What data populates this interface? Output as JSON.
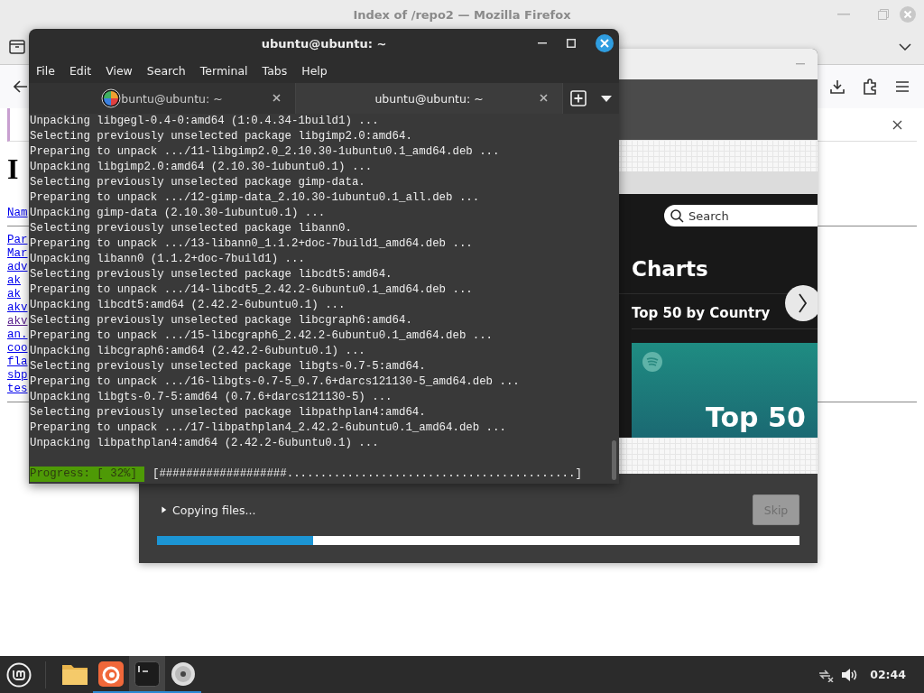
{
  "firefox": {
    "title": "Index of /repo2 — Mozilla Firefox",
    "page": {
      "heading": "I",
      "column_header": "Nam",
      "links": [
        {
          "text": "Par",
          "visited": false
        },
        {
          "text": "Mar",
          "visited": false
        },
        {
          "text": "adv",
          "visited": false
        },
        {
          "text": "ak",
          "visited": false
        },
        {
          "text": "ak",
          "visited": false
        },
        {
          "text": "akv",
          "visited": false
        },
        {
          "text": "akv",
          "visited": true
        },
        {
          "text": "an.",
          "visited": false
        },
        {
          "text": "coo",
          "visited": false
        },
        {
          "text": "fla",
          "visited": false
        },
        {
          "text": "sbp",
          "visited": false
        },
        {
          "text": "tes",
          "visited": false
        }
      ]
    }
  },
  "installer": {
    "slideshow": {
      "search": {
        "placeholder": "Search"
      },
      "title": "Charts",
      "section": "Top 50 by Country",
      "card_title": "Top 50"
    },
    "status": {
      "text": "Copying files...",
      "expanded": false
    },
    "skip": {
      "label": "Skip",
      "disabled": true
    },
    "progress": {
      "level": 0.243
    }
  },
  "terminal": {
    "title": "ubuntu@ubuntu: ~",
    "menu": [
      "File",
      "Edit",
      "View",
      "Search",
      "Terminal",
      "Tabs",
      "Help"
    ],
    "tabs": [
      {
        "label": "buntu@ubuntu: ~",
        "selected": false
      },
      {
        "label": "ubuntu@ubuntu: ~",
        "selected": true
      }
    ],
    "lines": [
      "Unpacking libgegl-0.4-0:amd64 (1:0.4.34-1build1) ...",
      "Selecting previously unselected package libgimp2.0:amd64.",
      "Preparing to unpack .../11-libgimp2.0_2.10.30-1ubuntu0.1_amd64.deb ...",
      "Unpacking libgimp2.0:amd64 (2.10.30-1ubuntu0.1) ...",
      "Selecting previously unselected package gimp-data.",
      "Preparing to unpack .../12-gimp-data_2.10.30-1ubuntu0.1_all.deb ...",
      "Unpacking gimp-data (2.10.30-1ubuntu0.1) ...",
      "Selecting previously unselected package libann0.",
      "Preparing to unpack .../13-libann0_1.1.2+doc-7build1_amd64.deb ...",
      "Unpacking libann0 (1.1.2+doc-7build1) ...",
      "Selecting previously unselected package libcdt5:amd64.",
      "Preparing to unpack .../14-libcdt5_2.42.2-6ubuntu0.1_amd64.deb ...",
      "Unpacking libcdt5:amd64 (2.42.2-6ubuntu0.1) ...",
      "Selecting previously unselected package libcgraph6:amd64.",
      "Preparing to unpack .../15-libcgraph6_2.42.2-6ubuntu0.1_amd64.deb ...",
      "Unpacking libcgraph6:amd64 (2.42.2-6ubuntu0.1) ...",
      "Selecting previously unselected package libgts-0.7-5:amd64.",
      "Preparing to unpack .../16-libgts-0.7-5_0.7.6+darcs121130-5_amd64.deb ...",
      "Unpacking libgts-0.7-5:amd64 (0.7.6+darcs121130-5) ...",
      "Selecting previously unselected package libpathplan4:amd64.",
      "Preparing to unpack .../17-libpathplan4_2.42.2-6ubuntu0.1_amd64.deb ...",
      "Unpacking libpathplan4:amd64 (2.42.2-6ubuntu0.1) ..."
    ],
    "progress": {
      "label": "Progress: [ 32%]",
      "bar": "[###################...........................................]"
    }
  },
  "taskbar": {
    "apps": [
      {
        "kind": "files",
        "running": false,
        "selected": false
      },
      {
        "kind": "firefox",
        "running": true,
        "selected": false
      },
      {
        "kind": "terminal",
        "running": true,
        "selected": true
      },
      {
        "kind": "disc",
        "running": true,
        "selected": false
      }
    ],
    "clock": "02:44"
  }
}
